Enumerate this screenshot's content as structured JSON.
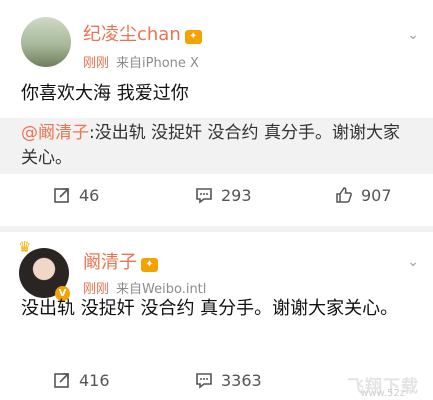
{
  "post1": {
    "username": "纪凌尘chan",
    "time": "刚刚",
    "source": "来自iPhone X",
    "text": "你喜欢大海 我爱过你",
    "quote_mention": "@阚清子",
    "quote_text": ":没出轨 没捉奸 没合约 真分手。谢谢大家关心。",
    "repost_count": "46",
    "comment_count": "293",
    "like_count": "907"
  },
  "post2": {
    "username": "阚清子",
    "time": "刚刚",
    "source": "来自Weibo.intl",
    "text": "没出轨 没捉奸 没合约 真分手。谢谢大家关心。",
    "repost_count": "416",
    "comment_count": "3363"
  },
  "watermark": "飞翔下载",
  "watermark_sub": "www.52z",
  "colors": {
    "accent": "#eb7350",
    "vip": "#f5a200",
    "bg": "#f2f2f2"
  }
}
